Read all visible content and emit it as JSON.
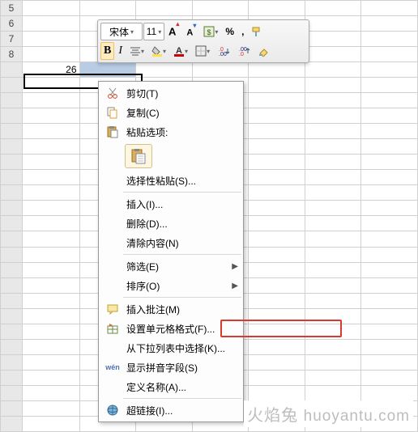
{
  "grid": {
    "rows": [
      {
        "hdr": "5",
        "cells": [
          "",
          "",
          "",
          "",
          "",
          "",
          ""
        ]
      },
      {
        "hdr": "6",
        "cells": [
          "",
          "",
          "",
          "",
          "",
          "",
          ""
        ]
      },
      {
        "hdr": "7",
        "cells": [
          "",
          "",
          "",
          "",
          "",
          "",
          ""
        ]
      },
      {
        "hdr": "8",
        "cells": [
          "",
          "",
          "",
          "",
          "",
          "",
          ""
        ]
      },
      {
        "hdr": "",
        "cells": [
          "26",
          "",
          "",
          "",
          "",
          "",
          ""
        ]
      },
      {
        "hdr": "",
        "cells": [
          "",
          "",
          "",
          "",
          "",
          "",
          ""
        ]
      },
      {
        "hdr": "",
        "cells": [
          "",
          "",
          "",
          "",
          "",
          "",
          ""
        ]
      },
      {
        "hdr": "",
        "cells": [
          "",
          "",
          "",
          "",
          "",
          "",
          ""
        ]
      },
      {
        "hdr": "",
        "cells": [
          "",
          "",
          "",
          "",
          "",
          "",
          ""
        ]
      },
      {
        "hdr": "",
        "cells": [
          "",
          "",
          "",
          "",
          "",
          "",
          ""
        ]
      },
      {
        "hdr": "",
        "cells": [
          "",
          "",
          "",
          "",
          "",
          "",
          ""
        ]
      },
      {
        "hdr": "",
        "cells": [
          "",
          "",
          "",
          "",
          "",
          "",
          ""
        ]
      },
      {
        "hdr": "",
        "cells": [
          "",
          "",
          "",
          "",
          "",
          "",
          ""
        ]
      },
      {
        "hdr": "",
        "cells": [
          "",
          "",
          "",
          "",
          "",
          "",
          ""
        ]
      },
      {
        "hdr": "",
        "cells": [
          "",
          "",
          "",
          "",
          "",
          "",
          ""
        ]
      },
      {
        "hdr": "",
        "cells": [
          "",
          "",
          "",
          "",
          "",
          "",
          ""
        ]
      },
      {
        "hdr": "",
        "cells": [
          "",
          "",
          "",
          "",
          "",
          "",
          ""
        ]
      },
      {
        "hdr": "",
        "cells": [
          "",
          "",
          "",
          "",
          "",
          "",
          ""
        ]
      },
      {
        "hdr": "",
        "cells": [
          "",
          "",
          "",
          "",
          "",
          "",
          ""
        ]
      },
      {
        "hdr": "",
        "cells": [
          "",
          "",
          "",
          "",
          "",
          "",
          ""
        ]
      },
      {
        "hdr": "",
        "cells": [
          "",
          "",
          "",
          "",
          "",
          "",
          ""
        ]
      },
      {
        "hdr": "",
        "cells": [
          "",
          "",
          "",
          "",
          "",
          "",
          ""
        ]
      },
      {
        "hdr": "",
        "cells": [
          "",
          "",
          "",
          "",
          "",
          "",
          ""
        ]
      },
      {
        "hdr": "",
        "cells": [
          "",
          "",
          "",
          "",
          "",
          "",
          ""
        ]
      },
      {
        "hdr": "",
        "cells": [
          "",
          "",
          "",
          "",
          "",
          "",
          ""
        ]
      },
      {
        "hdr": "",
        "cells": [
          "",
          "",
          "",
          "",
          "",
          "",
          ""
        ]
      },
      {
        "hdr": "",
        "cells": [
          "",
          "",
          "",
          "",
          "",
          "",
          ""
        ]
      },
      {
        "hdr": "",
        "cells": [
          "",
          "",
          "",
          "",
          "",
          "",
          ""
        ]
      }
    ]
  },
  "toolbar": {
    "font_name": "宋体",
    "font_size": "11",
    "grow_font": "A",
    "shrink_font": "A",
    "percent": "%",
    "comma": ",",
    "bold": "B",
    "italic": "I",
    "underline_color": "#c00",
    "fill_color": "#ffe04a",
    "decrease_decimal": ".0",
    "increase_decimal": ".00"
  },
  "context_menu": {
    "cut": "剪切(T)",
    "copy": "复制(C)",
    "paste_options_header": "粘贴选项:",
    "paste_special": "选择性粘贴(S)...",
    "insert": "插入(I)...",
    "delete": "删除(D)...",
    "clear_contents": "清除内容(N)",
    "filter": "筛选(E)",
    "sort": "排序(O)",
    "insert_comment": "插入批注(M)",
    "format_cells": "设置单元格格式(F)...",
    "pick_from_list": "从下拉列表中选择(K)...",
    "phonetic": "显示拼音字段(S)",
    "define_name": "定义名称(A)...",
    "hyperlink": "超链接(I)..."
  },
  "watermark": {
    "cn": "火焰兔",
    "en": "huoyantu.com"
  }
}
